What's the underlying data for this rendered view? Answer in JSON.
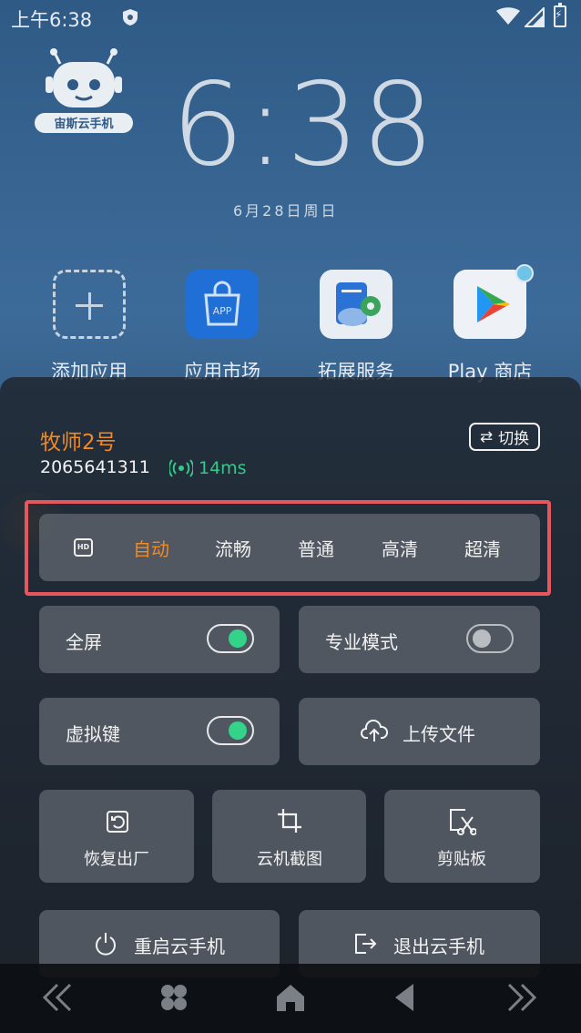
{
  "status_bar": {
    "time": "上午6:38"
  },
  "logo_text": "宙斯云手机",
  "clock": {
    "time": "6:38",
    "date": "6月28日周日"
  },
  "apps": [
    {
      "label": "添加应用",
      "icon": "add-dashed-icon"
    },
    {
      "label": "应用市场",
      "icon": "app-store-icon",
      "badge": "APP"
    },
    {
      "label": "拓展服务",
      "icon": "extension-service-icon"
    },
    {
      "label": "Play 商店",
      "icon": "play-store-icon"
    }
  ],
  "panel": {
    "device_name": "牧师2号",
    "device_id": "2065641311",
    "latency": "14ms",
    "switch_label": "切换",
    "quality": {
      "hd_icon": "HD",
      "options": [
        "自动",
        "流畅",
        "普通",
        "高清",
        "超清"
      ],
      "selected": "自动"
    },
    "toggles": {
      "fullscreen": {
        "label": "全屏",
        "on": true
      },
      "pro_mode": {
        "label": "专业模式",
        "on": false
      },
      "virtual_keys": {
        "label": "虚拟键",
        "on": true
      }
    },
    "upload_label": "上传文件",
    "actions": [
      {
        "label": "恢复出厂",
        "icon": "restore-icon"
      },
      {
        "label": "云机截图",
        "icon": "crop-icon"
      },
      {
        "label": "剪贴板",
        "icon": "clipboard-icon"
      }
    ],
    "restart_label": "重启云手机",
    "exit_label": "退出云手机"
  },
  "colors": {
    "accent": "#f08a24",
    "toggle_on": "#33d38a",
    "highlight": "#e8565d",
    "ping": "#34c88a"
  }
}
